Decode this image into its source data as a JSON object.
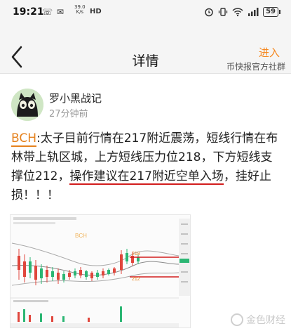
{
  "status_bar": {
    "time": "19:21",
    "net_speed_value": "39.0",
    "net_speed_unit": "K/s",
    "network": "HD",
    "battery": "59"
  },
  "header": {
    "title": "详情",
    "enter_label": "进入",
    "community_label": "币快报官方社群"
  },
  "post": {
    "author": "罗小黑战记",
    "time_ago": "27分钟前",
    "tag": "BCH",
    "text_part1": ":太子目前行情在217附近震荡，短线行情在布林带上轨区城，上方短线压力位218，下方短线支撑位212，",
    "text_highlight": "操作建议在217附近空单入场",
    "text_part2": "，挂好止损！！！"
  },
  "chart": {
    "symbol_label": "BCH",
    "resistance_label": "218",
    "support_label": "212",
    "accent_red": "#d21c1c",
    "bull_color": "#2bb673",
    "bear_color": "#e0463c"
  },
  "watermark": {
    "text": "金色财经"
  }
}
